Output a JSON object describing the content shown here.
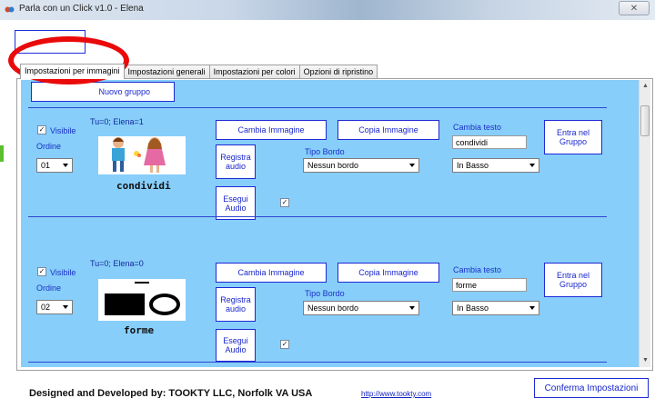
{
  "window": {
    "title": "Parla con un Click v1.0 - Elena",
    "close_label": "✕"
  },
  "tabs": [
    {
      "label": "Impostazioni per immagini",
      "active": true
    },
    {
      "label": "Impostazioni generali",
      "active": false
    },
    {
      "label": "Impostazioni per colori",
      "active": false
    },
    {
      "label": "Opzioni di ripristino",
      "active": false
    }
  ],
  "toolbar": {
    "new_group_label": "Nuovo gruppo"
  },
  "items": [
    {
      "visible_label": "Visibile",
      "visible_checked": true,
      "counts": "Tu=0;  Elena=1",
      "order_label": "Ordine",
      "order_value": "01",
      "caption": "condividi",
      "change_image_label": "Cambia Immagine",
      "copy_image_label": "Copia Immagine",
      "change_text_label": "Cambia testo",
      "text_value": "condividi",
      "enter_group_label": "Entra nel Gruppo",
      "record_audio_label": "Registra audio",
      "border_type_label": "Tipo Bordo",
      "border_value": "Nessun bordo",
      "position_value": "In Basso",
      "play_audio_label": "Esegui Audio",
      "play_audio_checked": true
    },
    {
      "visible_label": "Visibile",
      "visible_checked": true,
      "counts": "Tu=0;  Elena=0",
      "order_label": "Ordine",
      "order_value": "02",
      "caption": "forme",
      "change_image_label": "Cambia Immagine",
      "copy_image_label": "Copia Immagine",
      "change_text_label": "Cambia testo",
      "text_value": "forme",
      "enter_group_label": "Entra nel Gruppo",
      "record_audio_label": "Registra audio",
      "border_type_label": "Tipo Bordo",
      "border_value": "Nessun bordo",
      "position_value": "In Basso",
      "play_audio_label": "Esegui Audio",
      "play_audio_checked": true
    }
  ],
  "footer": {
    "credit": "Designed and Developed by:  TOOKTY  LLC,  Norfolk VA USA",
    "link": "http://www.tookty.com",
    "confirm_label": "Conferma Impostazioni"
  },
  "colors": {
    "panel_bg": "#87cefa",
    "accent": "#1c2ad4",
    "annotation": "#ea0a0a"
  }
}
